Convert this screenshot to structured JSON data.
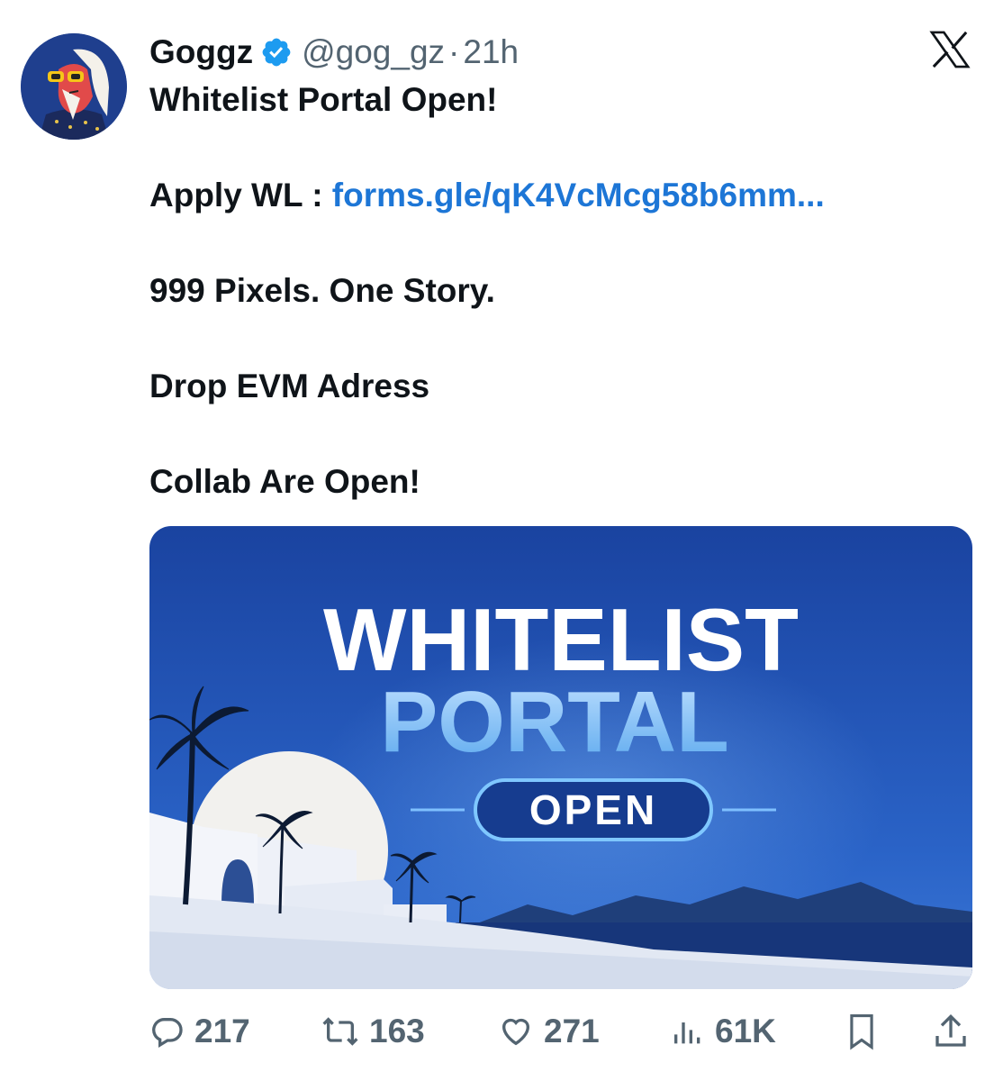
{
  "tweet": {
    "author_name": "Goggz",
    "handle": "@gog_gz",
    "separator": "·",
    "time": "21h",
    "lines": {
      "line1": "Whitelist Portal Open!",
      "apply_label": "Apply WL : ",
      "apply_link": "forms.gle/qK4VcMcg58b6mm...",
      "line3": "999 Pixels. One Story.",
      "line4": "Drop EVM Adress",
      "line5": "Collab Are Open!"
    }
  },
  "media": {
    "title_line1": "WHITELIST",
    "title_line2": "PORTAL",
    "badge": "OPEN"
  },
  "actions": {
    "replies": "217",
    "reposts": "163",
    "likes": "271",
    "views": "61K"
  },
  "icons": {
    "verified": "verified-badge-icon",
    "close": "x-logo-icon",
    "reply": "reply-icon",
    "repost": "repost-icon",
    "like": "heart-icon",
    "views": "views-icon",
    "bookmark": "bookmark-icon",
    "share": "share-icon"
  },
  "colors": {
    "link": "#1d76d6",
    "verified": "#1d9bf0",
    "secondary_text": "#536471",
    "banner_blue": "#1d4fb0"
  }
}
